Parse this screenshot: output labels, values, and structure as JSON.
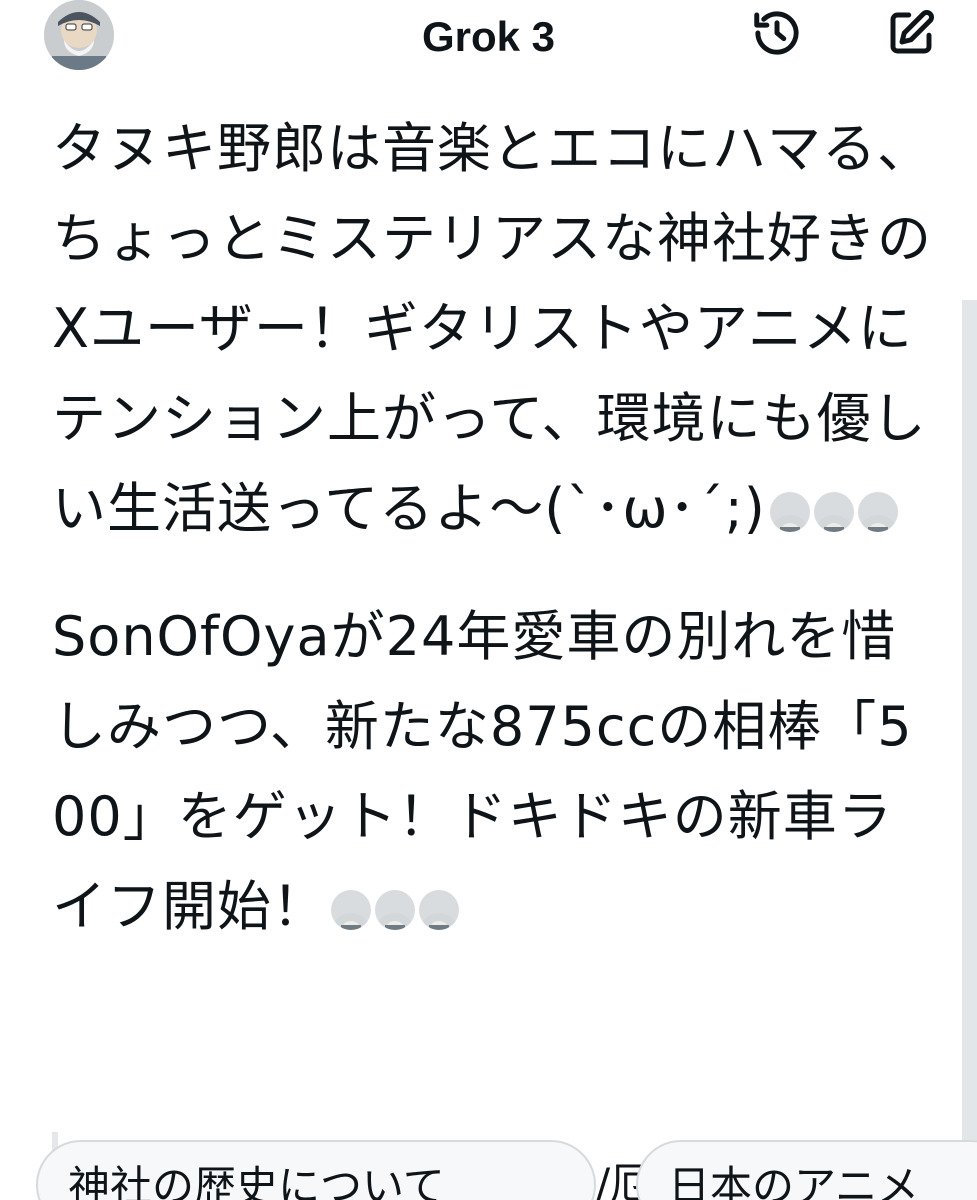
{
  "header": {
    "title": "Grok 3",
    "avatar_icon": "user-avatar",
    "history_icon": "history-icon",
    "compose_icon": "compose-edit-icon"
  },
  "messages": [
    {
      "text": "タヌキ野郎は音楽とエコにハマる、ちょっとミステリアスな神社好きのXユーザー！ギタリストやアニメにテンション上がって、環境にも優しい生活送ってるよ〜(`･ω･´;)",
      "emoji_count": 3
    },
    {
      "text": "SonOfOyaが24年愛車の別れを惜しみつつ、新たな875ccの相棒「500」をゲット！ドキドキの新車ライフ開始！",
      "emoji_count": 3
    }
  ],
  "suggestions": [
    {
      "label": "神社の歴史について"
    },
    {
      "label": "日本のアニメ"
    }
  ],
  "suggestion_separator": "/厄",
  "colors": {
    "text": "#0f1419",
    "chip_border": "#d6dadd",
    "scrollbar": "#e3e6e8"
  }
}
